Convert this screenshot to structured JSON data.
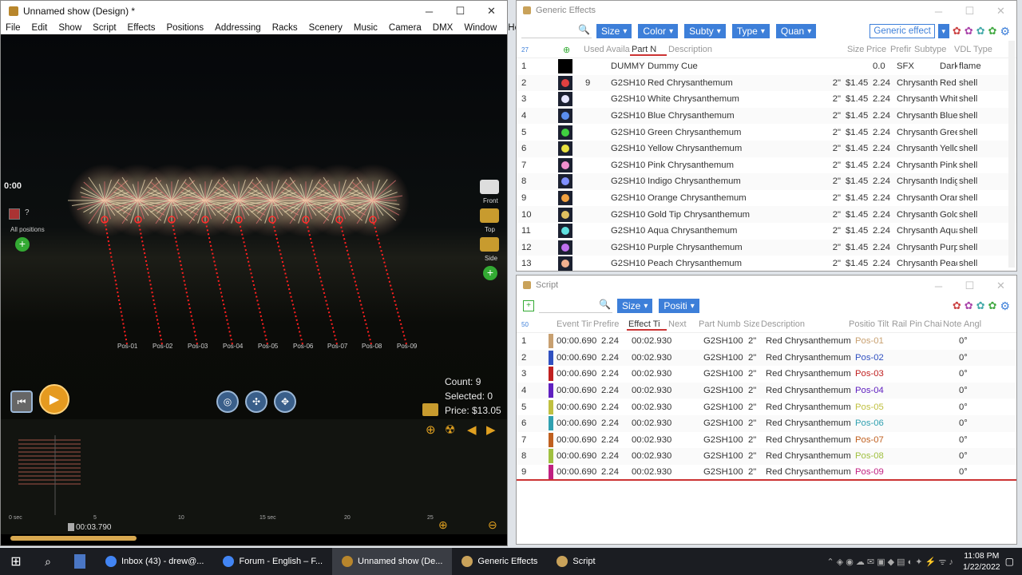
{
  "main_window": {
    "title": "Unnamed show (Design) *",
    "menu": [
      "File",
      "Edit",
      "Show",
      "Script",
      "Effects",
      "Positions",
      "Addressing",
      "Racks",
      "Scenery",
      "Music",
      "Camera",
      "DMX",
      "Window",
      "Help"
    ],
    "viewport": {
      "time": "0:00",
      "all_positions_label": "All positions",
      "cam_labels": [
        "Front",
        "Top",
        "Side"
      ],
      "positions": [
        "Pos-01",
        "Pos-02",
        "Pos-03",
        "Pos-04",
        "Pos-05",
        "Pos-06",
        "Pos-07",
        "Pos-08",
        "Pos-09"
      ],
      "count": "Count: 9",
      "selected": "Selected: 0",
      "price": "Price: $13.05"
    },
    "timeline": {
      "current_time": "00:03.790",
      "ticks": [
        "0 sec",
        "5",
        "10",
        "15 sec",
        "20",
        "25"
      ]
    }
  },
  "generic_effects": {
    "title": "Generic Effects",
    "filters": [
      "Size",
      "Color",
      "Subty",
      "Type",
      "Quan"
    ],
    "library_select": "Generic effect",
    "count": "27",
    "columns": [
      "Used",
      "Availa",
      "Part N",
      "Description",
      "Size",
      "Price",
      "Prefir",
      "Subtype",
      "VDL",
      "Type"
    ],
    "rows": [
      {
        "n": "1",
        "used": "",
        "part": "DUMMY",
        "desc": "Dummy Cue",
        "size": "",
        "price": "",
        "prefire": "0.0",
        "subtype": "SFX",
        "vdl": "Dark",
        "type": "flame",
        "color": "#000000"
      },
      {
        "n": "2",
        "used": "9",
        "part": "G2SH10",
        "desc": "Red Chrysanthemum",
        "size": "2\"",
        "price": "$1.45",
        "prefire": "2.24",
        "subtype": "Chrysanth",
        "vdl": "Red",
        "type": "shell",
        "color": "#e04040"
      },
      {
        "n": "3",
        "used": "",
        "part": "G2SH10",
        "desc": "White Chrysanthemum",
        "size": "2\"",
        "price": "$1.45",
        "prefire": "2.24",
        "subtype": "Chrysanth",
        "vdl": "Whit",
        "type": "shell",
        "color": "#e6e6ff"
      },
      {
        "n": "4",
        "used": "",
        "part": "G2SH10",
        "desc": "Blue Chrysanthemum",
        "size": "2\"",
        "price": "$1.45",
        "prefire": "2.24",
        "subtype": "Chrysanth",
        "vdl": "Blue",
        "type": "shell",
        "color": "#5a8ef0"
      },
      {
        "n": "5",
        "used": "",
        "part": "G2SH10",
        "desc": "Green Chrysanthemum",
        "size": "2\"",
        "price": "$1.45",
        "prefire": "2.24",
        "subtype": "Chrysanth",
        "vdl": "Gree",
        "type": "shell",
        "color": "#40d040"
      },
      {
        "n": "6",
        "used": "",
        "part": "G2SH10",
        "desc": "Yellow Chrysanthemum",
        "size": "2\"",
        "price": "$1.45",
        "prefire": "2.24",
        "subtype": "Chrysanth",
        "vdl": "Yello",
        "type": "shell",
        "color": "#e8e040"
      },
      {
        "n": "7",
        "used": "",
        "part": "G2SH10",
        "desc": "Pink Chrysanthemum",
        "size": "2\"",
        "price": "$1.45",
        "prefire": "2.24",
        "subtype": "Chrysanth",
        "vdl": "Pink",
        "type": "shell",
        "color": "#f090d0"
      },
      {
        "n": "8",
        "used": "",
        "part": "G2SH10",
        "desc": "Indigo Chrysanthemum",
        "size": "2\"",
        "price": "$1.45",
        "prefire": "2.24",
        "subtype": "Chrysanth",
        "vdl": "Indig",
        "type": "shell",
        "color": "#8090ff"
      },
      {
        "n": "9",
        "used": "",
        "part": "G2SH10",
        "desc": "Orange Chrysanthemum",
        "size": "2\"",
        "price": "$1.45",
        "prefire": "2.24",
        "subtype": "Chrysanth",
        "vdl": "Oran",
        "type": "shell",
        "color": "#f0a040"
      },
      {
        "n": "10",
        "used": "",
        "part": "G2SH10",
        "desc": "Gold Tip Chrysanthemum",
        "size": "2\"",
        "price": "$1.45",
        "prefire": "2.24",
        "subtype": "Chrysanth",
        "vdl": "Gold",
        "type": "shell",
        "color": "#e0c060"
      },
      {
        "n": "11",
        "used": "",
        "part": "G2SH10",
        "desc": "Aqua Chrysanthemum",
        "size": "2\"",
        "price": "$1.45",
        "prefire": "2.24",
        "subtype": "Chrysanth",
        "vdl": "Aqua",
        "type": "shell",
        "color": "#60e0e0"
      },
      {
        "n": "12",
        "used": "",
        "part": "G2SH10",
        "desc": "Purple Chrysanthemum",
        "size": "2\"",
        "price": "$1.45",
        "prefire": "2.24",
        "subtype": "Chrysanth",
        "vdl": "Purp",
        "type": "shell",
        "color": "#c070f0"
      },
      {
        "n": "13",
        "used": "",
        "part": "G2SH10",
        "desc": "Peach Chrysanthemum",
        "size": "2\"",
        "price": "$1.45",
        "prefire": "2.24",
        "subtype": "Chrysanth",
        "vdl": "Peac",
        "type": "shell",
        "color": "#f0b090"
      }
    ]
  },
  "script": {
    "title": "Script",
    "filters": [
      "Size",
      "Positi"
    ],
    "count": "50",
    "columns": [
      "Event Time",
      "Prefire",
      "Effect Ti",
      "Next",
      "Part Numb",
      "Size",
      "Description",
      "Positio",
      "Tilt",
      "Rail",
      "Pin",
      "Chai",
      "Notes",
      "Angl"
    ],
    "rows": [
      {
        "n": "1",
        "event": "00:00.690",
        "prefire": "2.24",
        "effect": "00:02.930",
        "part": "G2SH100",
        "size": "2\"",
        "desc": "Red Chrysanthemum",
        "pos": "Pos-01",
        "angle": "0°",
        "bar": "#c8a070",
        "poscolor": "#c8a070"
      },
      {
        "n": "2",
        "event": "00:00.690",
        "prefire": "2.24",
        "effect": "00:02.930",
        "part": "G2SH100",
        "size": "2\"",
        "desc": "Red Chrysanthemum",
        "pos": "Pos-02",
        "angle": "0°",
        "bar": "#3050c0",
        "poscolor": "#3050c0"
      },
      {
        "n": "3",
        "event": "00:00.690",
        "prefire": "2.24",
        "effect": "00:02.930",
        "part": "G2SH100",
        "size": "2\"",
        "desc": "Red Chrysanthemum",
        "pos": "Pos-03",
        "angle": "0°",
        "bar": "#c02020",
        "poscolor": "#c02020"
      },
      {
        "n": "4",
        "event": "00:00.690",
        "prefire": "2.24",
        "effect": "00:02.930",
        "part": "G2SH100",
        "size": "2\"",
        "desc": "Red Chrysanthemum",
        "pos": "Pos-04",
        "angle": "0°",
        "bar": "#6020c0",
        "poscolor": "#6020c0"
      },
      {
        "n": "5",
        "event": "00:00.690",
        "prefire": "2.24",
        "effect": "00:02.930",
        "part": "G2SH100",
        "size": "2\"",
        "desc": "Red Chrysanthemum",
        "pos": "Pos-05",
        "angle": "0°",
        "bar": "#c0c040",
        "poscolor": "#c0c040"
      },
      {
        "n": "6",
        "event": "00:00.690",
        "prefire": "2.24",
        "effect": "00:02.930",
        "part": "G2SH100",
        "size": "2\"",
        "desc": "Red Chrysanthemum",
        "pos": "Pos-06",
        "angle": "0°",
        "bar": "#30a0b0",
        "poscolor": "#30a0b0"
      },
      {
        "n": "7",
        "event": "00:00.690",
        "prefire": "2.24",
        "effect": "00:02.930",
        "part": "G2SH100",
        "size": "2\"",
        "desc": "Red Chrysanthemum",
        "pos": "Pos-07",
        "angle": "0°",
        "bar": "#c06020",
        "poscolor": "#c06020"
      },
      {
        "n": "8",
        "event": "00:00.690",
        "prefire": "2.24",
        "effect": "00:02.930",
        "part": "G2SH100",
        "size": "2\"",
        "desc": "Red Chrysanthemum",
        "pos": "Pos-08",
        "angle": "0°",
        "bar": "#a0c040",
        "poscolor": "#a0c040"
      },
      {
        "n": "9",
        "event": "00:00.690",
        "prefire": "2.24",
        "effect": "00:02.930",
        "part": "G2SH100",
        "size": "2\"",
        "desc": "Red Chrysanthemum",
        "pos": "Pos-09",
        "angle": "0°",
        "bar": "#c02080",
        "poscolor": "#c02080"
      }
    ]
  },
  "taskbar": {
    "items": [
      {
        "label": "Inbox (43) - drew@...",
        "color": "#4285f4"
      },
      {
        "label": "Forum - English – F...",
        "color": "#4285f4"
      },
      {
        "label": "Unnamed show (De...",
        "color": "#b8862c"
      },
      {
        "label": "Generic Effects",
        "color": "#c9a25a"
      },
      {
        "label": "Script",
        "color": "#c9a25a"
      }
    ],
    "time": "11:08 PM",
    "date": "1/22/2022"
  }
}
